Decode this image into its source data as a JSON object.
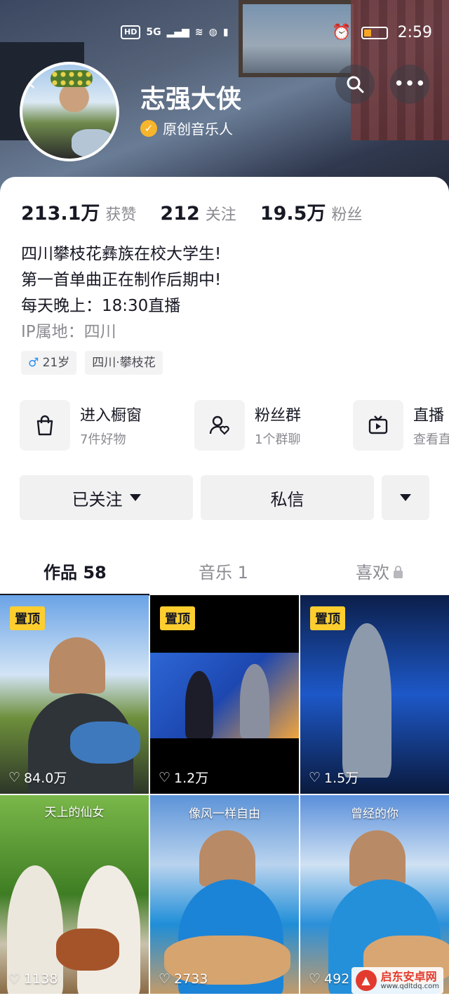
{
  "status_bar": {
    "network_badge": "HD",
    "network_type": "5G",
    "time": "2:59"
  },
  "profile": {
    "name": "志强大侠",
    "verification": "原创音乐人",
    "stats": [
      {
        "value": "213.1万",
        "label": "获赞"
      },
      {
        "value": "212",
        "label": "关注"
      },
      {
        "value": "19.5万",
        "label": "粉丝"
      }
    ],
    "bio_lines": [
      "四川攀枝花彝族在校大学生!",
      "第一首单曲正在制作后期中!",
      "每天晚上：18:30直播"
    ],
    "ip_location": "IP属地：四川",
    "tags": {
      "gender_age": "21岁",
      "gender_symbol": "♂",
      "location": "四川·攀枝花"
    }
  },
  "shortcuts": [
    {
      "title": "进入橱窗",
      "subtitle": "7件好物",
      "icon": "shopping-bag-icon"
    },
    {
      "title": "粉丝群",
      "subtitle": "1个群聊",
      "icon": "fan-group-icon"
    },
    {
      "title": "直播",
      "subtitle": "查看直",
      "icon": "tv-icon"
    }
  ],
  "actions": {
    "follow_label": "已关注",
    "message_label": "私信"
  },
  "tabs": [
    {
      "label": "作品 58",
      "active": true
    },
    {
      "label": "音乐 1",
      "active": false
    },
    {
      "label": "喜欢",
      "active": false,
      "locked": true
    }
  ],
  "videos": [
    {
      "pinned": true,
      "pin_label": "置顶",
      "likes": "84.0万",
      "caption": ""
    },
    {
      "pinned": true,
      "pin_label": "置顶",
      "likes": "1.2万",
      "caption": ""
    },
    {
      "pinned": true,
      "pin_label": "置顶",
      "likes": "1.5万",
      "caption": ""
    },
    {
      "pinned": false,
      "likes": "1138",
      "caption": "天上的仙女"
    },
    {
      "pinned": false,
      "likes": "2733",
      "caption": "像风一样自由"
    },
    {
      "pinned": false,
      "likes": "492",
      "caption": "曾经的你"
    }
  ],
  "watermark": {
    "title": "启东安卓网",
    "url": "www.qdltdq.com"
  }
}
